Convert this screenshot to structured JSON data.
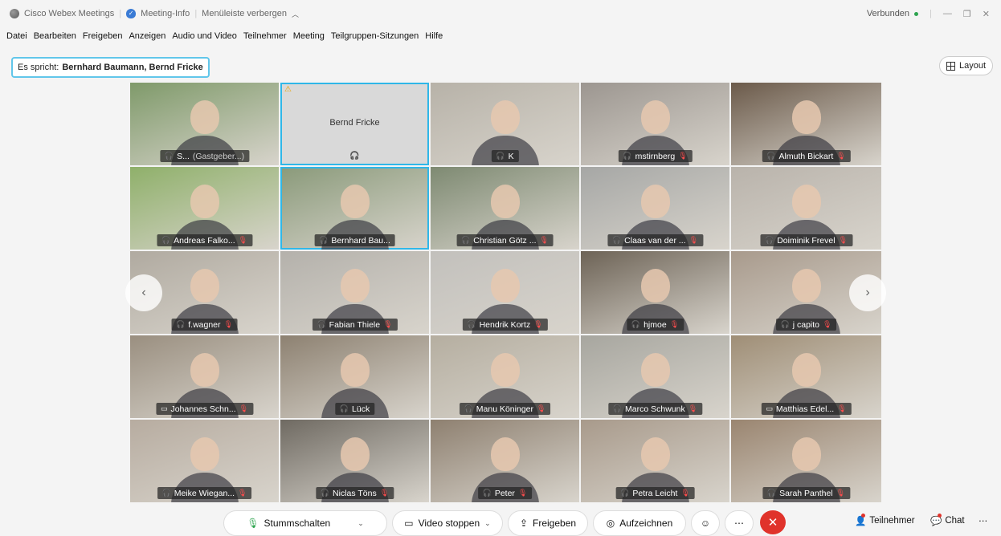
{
  "titlebar": {
    "app_name": "Cisco Webex Meetings",
    "meeting_info": "Meeting-Info",
    "hide_menu": "Menüleiste verbergen",
    "status": "Verbunden"
  },
  "menu": [
    "Datei",
    "Bearbeiten",
    "Freigeben",
    "Anzeigen",
    "Audio und Video",
    "Teilnehmer",
    "Meeting",
    "Teilgruppen-Sitzungen",
    "Hilfe"
  ],
  "speaker": {
    "prefix": "Es spricht:",
    "names": "Bernhard Baumann, Bernd Fricke"
  },
  "layout_label": "Layout",
  "tiles": [
    {
      "name": "S...",
      "extra": "(Gastgeber...)",
      "type": "mic",
      "muted": false,
      "bg": "#7f9a6a"
    },
    {
      "name": "Bernd Fricke",
      "type": "placeholder",
      "muted": false,
      "bg": "#d9d9d9"
    },
    {
      "name": "K",
      "type": "mic",
      "muted": false,
      "bg": "#b7b2a8"
    },
    {
      "name": "mstirnberg",
      "type": "mic",
      "muted": true,
      "bg": "#9c9690"
    },
    {
      "name": "Almuth Bickart",
      "type": "mic",
      "muted": true,
      "bg": "#6b5a4a"
    },
    {
      "name": "Andreas Falko...",
      "type": "mic",
      "muted": true,
      "bg": "#8fb06a"
    },
    {
      "name": "Bernhard Bau...",
      "type": "mic",
      "muted": false,
      "bg": "#8a9a7a"
    },
    {
      "name": "Christian Götz ...",
      "type": "mic",
      "muted": true,
      "bg": "#7e8a72"
    },
    {
      "name": "Claas van der ...",
      "type": "mic",
      "muted": true,
      "bg": "#a6a7a5"
    },
    {
      "name": "Doiminik Frevel",
      "type": "mic",
      "muted": true,
      "bg": "#b9b3ab"
    },
    {
      "name": "f.wagner",
      "type": "mic",
      "muted": true,
      "bg": "#b0aaa0"
    },
    {
      "name": "Fabian Thiele",
      "type": "mic",
      "muted": true,
      "bg": "#b4b1ab"
    },
    {
      "name": "Hendrik Kortz",
      "type": "mic",
      "muted": true,
      "bg": "#c2c0bc"
    },
    {
      "name": "hjmoe",
      "type": "mic",
      "muted": true,
      "bg": "#6d6356"
    },
    {
      "name": "j capito",
      "type": "mic",
      "muted": true,
      "bg": "#a89a8c"
    },
    {
      "name": "Johannes Schn...",
      "type": "cam",
      "muted": true,
      "bg": "#9a8f80"
    },
    {
      "name": "Lück",
      "type": "mic",
      "muted": false,
      "bg": "#8d8171"
    },
    {
      "name": "Manu Köninger",
      "type": "mic",
      "muted": true,
      "bg": "#b5aea0"
    },
    {
      "name": "Marco Schwunk",
      "type": "mic",
      "muted": true,
      "bg": "#a7a69f"
    },
    {
      "name": "Matthias Edel...",
      "type": "cam",
      "muted": true,
      "bg": "#9f8e76"
    },
    {
      "name": "Meike Wiegan...",
      "type": "mic",
      "muted": true,
      "bg": "#b7aca0"
    },
    {
      "name": "Niclas Töns",
      "type": "mic",
      "muted": true,
      "bg": "#6f6a62"
    },
    {
      "name": "Peter",
      "type": "mic",
      "muted": true,
      "bg": "#8e8070"
    },
    {
      "name": "Petra Leicht",
      "type": "mic",
      "muted": true,
      "bg": "#a89a8b"
    },
    {
      "name": "Sarah Panthel",
      "type": "mic",
      "muted": true,
      "bg": "#9a8570"
    }
  ],
  "toolbar": {
    "mute": "Stummschalten",
    "video": "Video stoppen",
    "share": "Freigeben",
    "record": "Aufzeichnen",
    "participants": "Teilnehmer",
    "chat": "Chat"
  }
}
